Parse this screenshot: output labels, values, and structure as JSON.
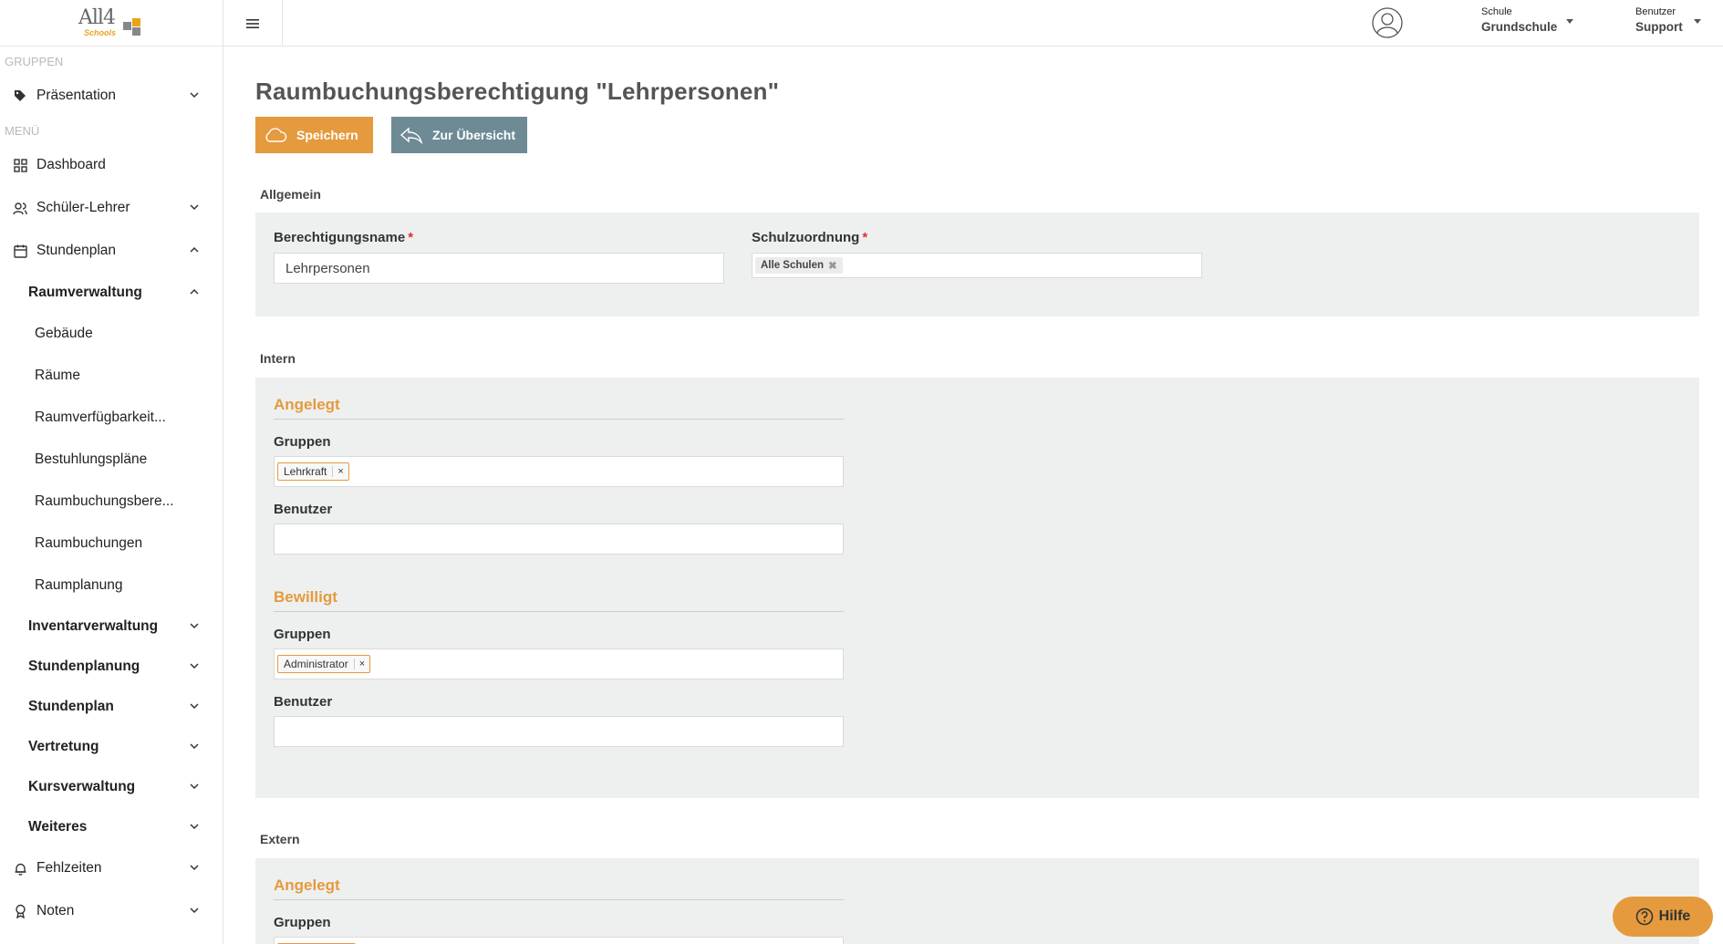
{
  "brand": {
    "logo_main": "All4",
    "logo_sub": "Schools"
  },
  "sidebar": {
    "groups_label": "GRUPPEN",
    "menu_label": "MENÜ",
    "presentation": "Präsentation",
    "items": [
      {
        "label": "Dashboard"
      },
      {
        "label": "Schüler-Lehrer"
      },
      {
        "label": "Stundenplan"
      },
      {
        "label": "Raumverwaltung"
      },
      {
        "label": "Gebäude"
      },
      {
        "label": "Räume"
      },
      {
        "label": "Raumverfügbarkeit..."
      },
      {
        "label": "Bestuhlungspläne"
      },
      {
        "label": "Raumbuchungsbere..."
      },
      {
        "label": "Raumbuchungen"
      },
      {
        "label": "Raumplanung"
      },
      {
        "label": "Inventarverwaltung"
      },
      {
        "label": "Stundenplanung"
      },
      {
        "label": "Stundenplan"
      },
      {
        "label": "Vertretung"
      },
      {
        "label": "Kursverwaltung"
      },
      {
        "label": "Weiteres"
      },
      {
        "label": "Fehlzeiten"
      },
      {
        "label": "Noten"
      }
    ]
  },
  "topbar": {
    "school_label": "Schule",
    "school_value": "Grundschule",
    "user_label": "Benutzer",
    "user_value": "Support"
  },
  "page": {
    "title": "Raumbuchungsberechtigung \"Lehrpersonen\"",
    "save_label": "Speichern",
    "overview_label": "Zur Übersicht"
  },
  "general": {
    "section_label": "Allgemein",
    "name_label": "Berechtigungsname",
    "name_value": "Lehrpersonen",
    "school_label": "Schulzuordnung",
    "school_tag": "Alle Schulen",
    "required_mark": "*"
  },
  "intern": {
    "section_label": "Intern",
    "created": {
      "heading": "Angelegt",
      "groups_label": "Gruppen",
      "group_tag": "Lehrkraft",
      "users_label": "Benutzer"
    },
    "approved": {
      "heading": "Bewilligt",
      "groups_label": "Gruppen",
      "group_tag": "Administrator",
      "users_label": "Benutzer"
    }
  },
  "extern": {
    "section_label": "Extern",
    "created": {
      "heading": "Angelegt",
      "groups_label": "Gruppen"
    }
  },
  "help": {
    "label": "Hilfe"
  },
  "colors": {
    "accent": "#e59a3e",
    "secondary_button": "#6e8b95",
    "panel": "#eef0f0"
  }
}
